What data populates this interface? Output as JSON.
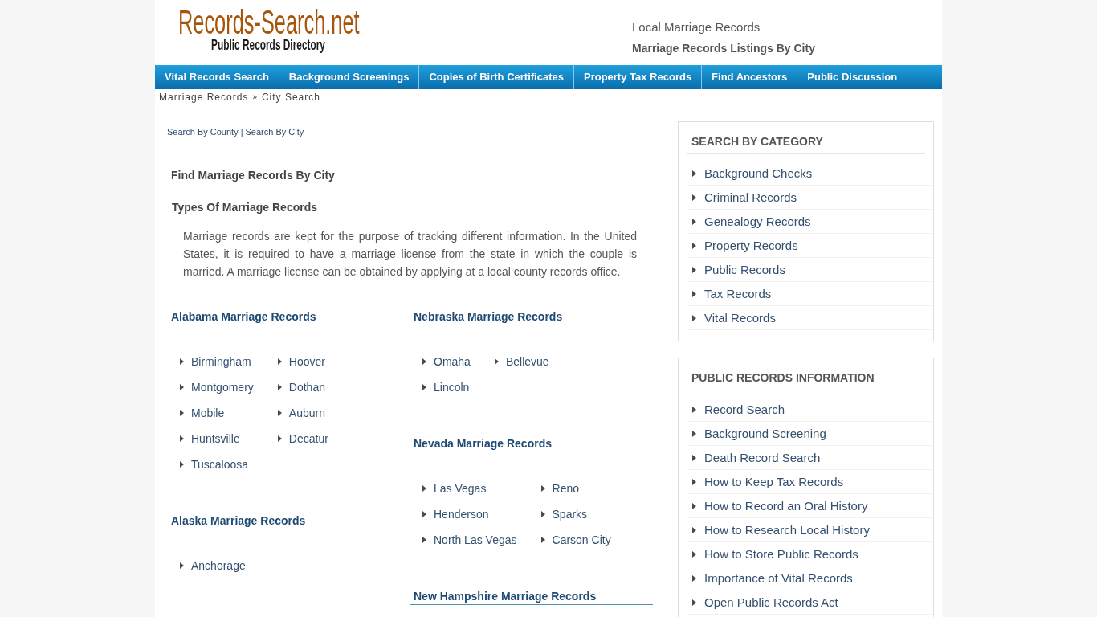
{
  "logo": {
    "title": "Records-Search.net",
    "tagline": "Public Records Directory"
  },
  "header": {
    "subtitle": "Local Marriage Records",
    "heading": "Marriage Records Listings By City"
  },
  "nav": [
    "Vital Records Search",
    "Background Screenings",
    "Copies of Birth Certificates",
    "Property Tax Records",
    "Find Ancestors",
    "Public Discussion"
  ],
  "breadcrumb": {
    "items": [
      "Marriage Records",
      "City Search"
    ],
    "separator": "»"
  },
  "search_links": {
    "items": [
      "Search By County",
      "Search By City"
    ],
    "separator": "|"
  },
  "page_title": "Find Marriage Records By City",
  "article": {
    "heading": "Types Of Marriage Records",
    "text": "Marriage records are kept for the purpose of tracking different information. In the United States, it is required to have a marriage license from the state in which the couple is married. A marriage license can be obtained by applying at a local county records office."
  },
  "state_columns": [
    [
      {
        "heading": "Alabama Marriage Records",
        "city_columns": [
          [
            "Birmingham",
            "Montgomery",
            "Mobile",
            "Huntsville",
            "Tuscaloosa"
          ],
          [
            "Hoover",
            "Dothan",
            "Auburn",
            "Decatur"
          ]
        ]
      },
      {
        "heading": "Alaska Marriage Records",
        "city_columns": [
          [
            "Anchorage"
          ]
        ]
      }
    ],
    [
      {
        "heading": "Nebraska Marriage Records",
        "city_columns": [
          [
            "Omaha",
            "Lincoln"
          ],
          [
            "Bellevue"
          ]
        ]
      },
      {
        "heading": "Nevada Marriage Records",
        "city_columns": [
          [
            "Las Vegas",
            "Henderson",
            "North Las Vegas"
          ],
          [
            "Reno",
            "Sparks",
            "Carson City"
          ]
        ]
      },
      {
        "heading": "New Hampshire Marriage Records"
      }
    ]
  ],
  "sidebar": [
    {
      "title": "SEARCH BY CATEGORY",
      "links": [
        "Background Checks",
        "Criminal Records",
        "Genealogy Records",
        "Property Records",
        "Public Records",
        "Tax Records",
        "Vital Records"
      ]
    },
    {
      "title": "PUBLIC RECORDS INFORMATION",
      "links": [
        "Record Search",
        "Background Screening",
        "Death Record Search",
        "How to Keep Tax Records",
        "How to Record an Oral History",
        "How to Research Local History",
        "How to Store Public Records",
        "Importance of Vital Records",
        "Open Public Records Act"
      ]
    }
  ]
}
